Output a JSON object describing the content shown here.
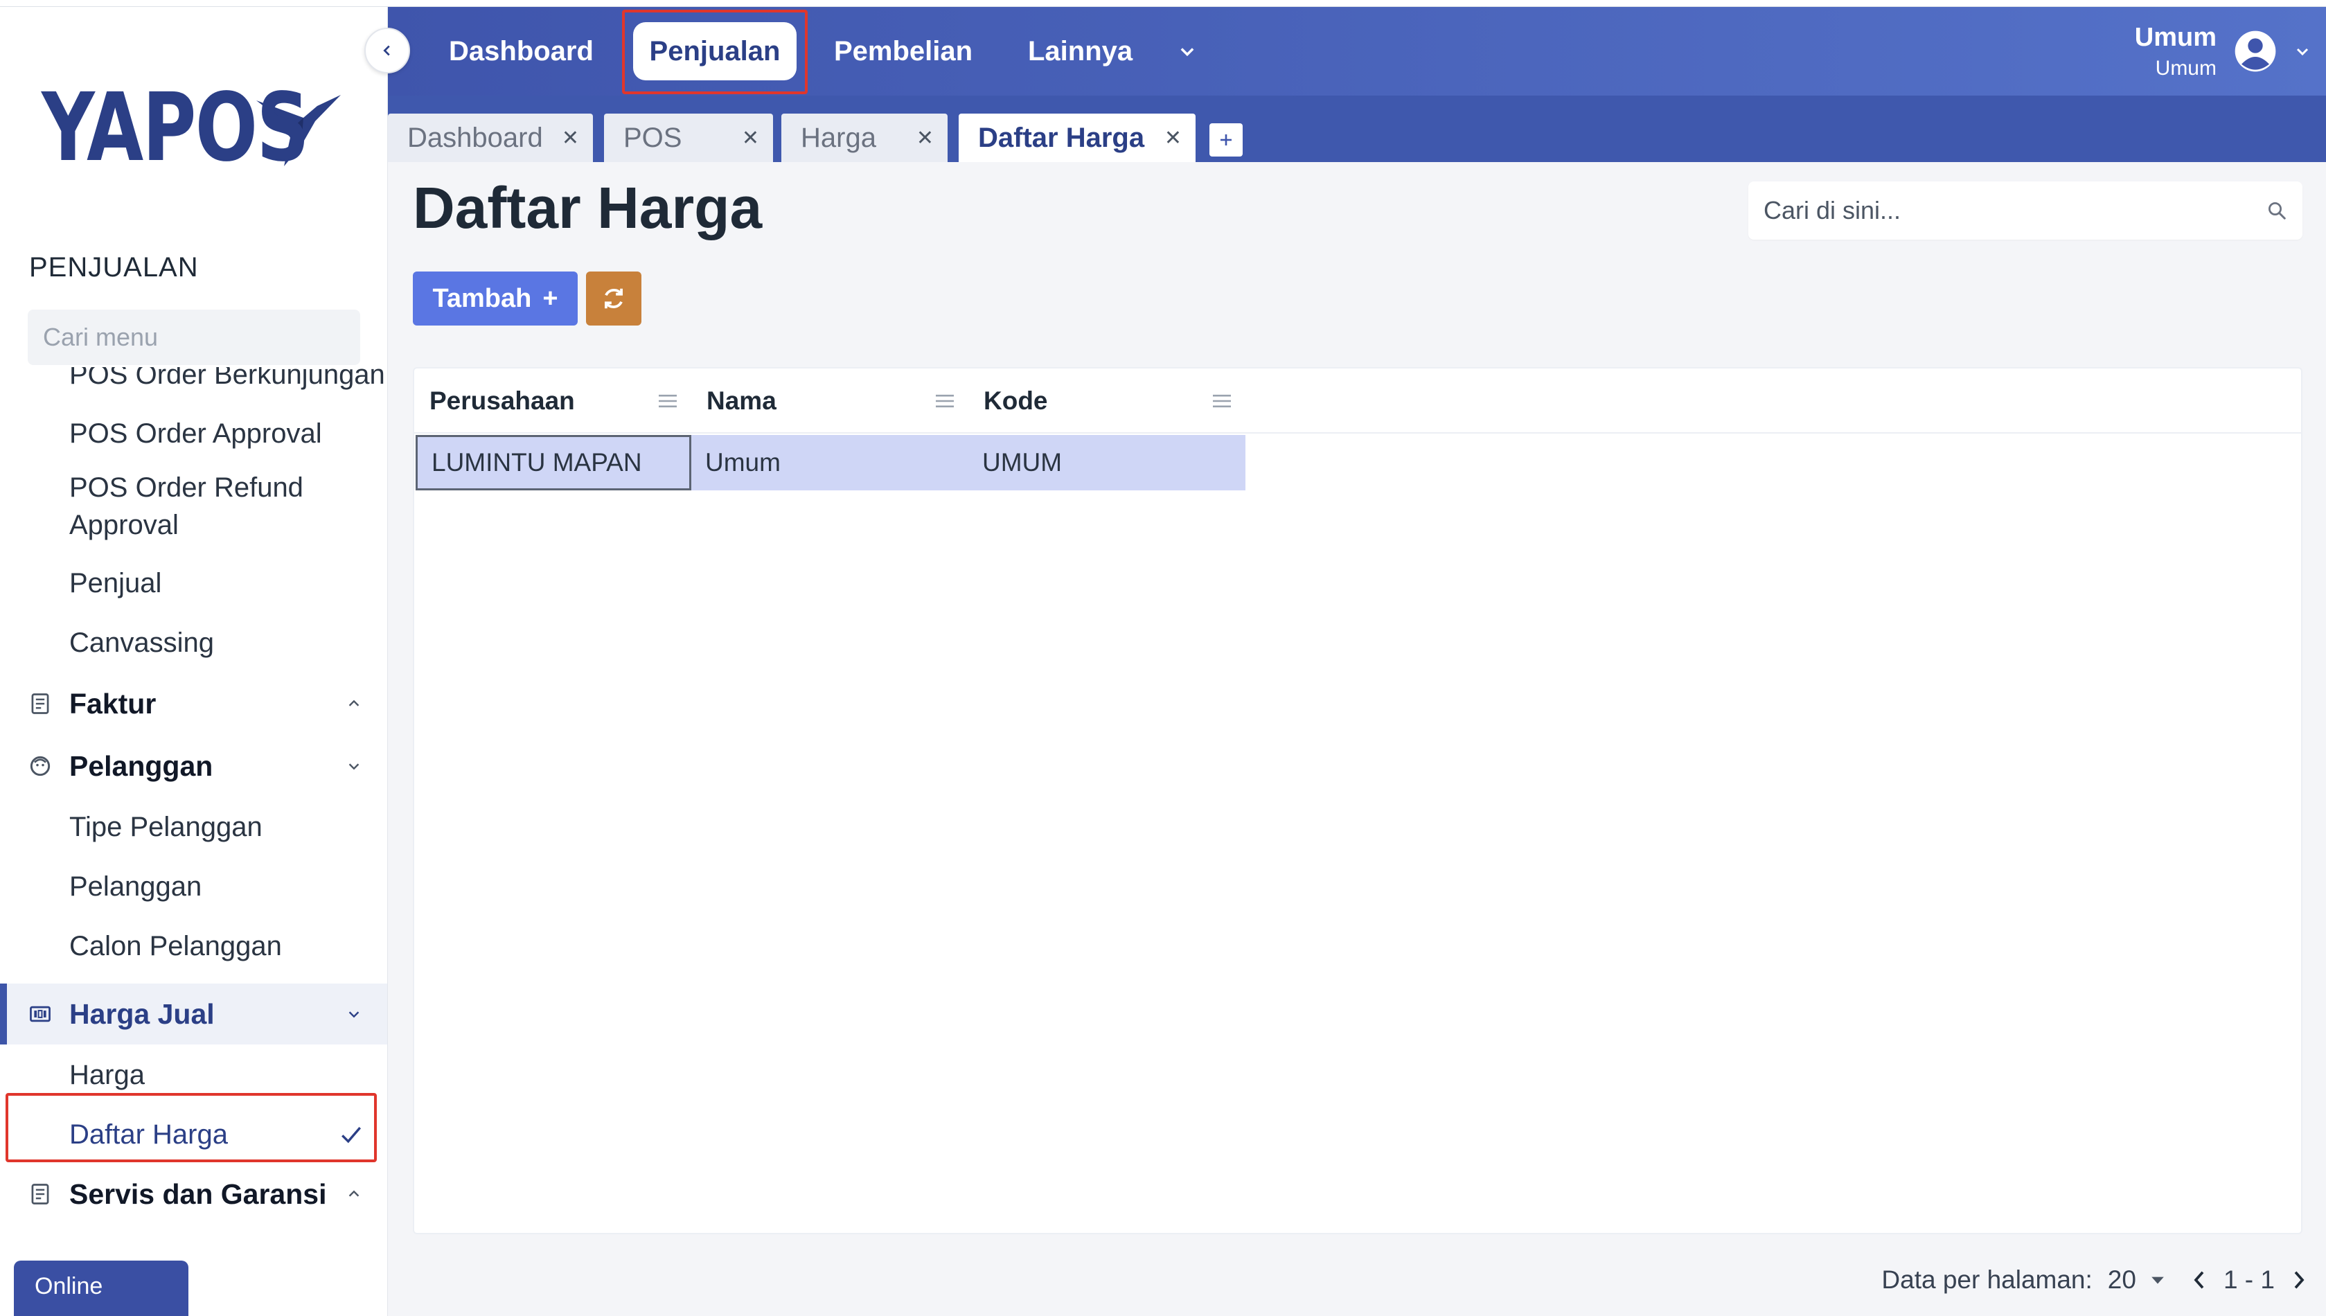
{
  "app": {
    "logo_text": "YAPOS",
    "status": "Online"
  },
  "sidebar": {
    "section_title": "PENJUALAN",
    "search_placeholder": "Cari menu",
    "partial_item": "POS Order Berkunjungan",
    "items": {
      "pos_order_approval": "POS Order Approval",
      "pos_order_refund_l1": "POS Order Refund",
      "pos_order_refund_l2": "Approval",
      "penjual": "Penjual",
      "canvassing": "Canvassing",
      "faktur": "Faktur",
      "pelanggan": "Pelanggan",
      "tipe_pelanggan": "Tipe Pelanggan",
      "pelanggan_sub": "Pelanggan",
      "calon_pelanggan": "Calon Pelanggan",
      "harga_jual": "Harga Jual",
      "harga": "Harga",
      "daftar_harga": "Daftar Harga",
      "servis_garansi": "Servis dan Garansi"
    }
  },
  "topnav": {
    "items": [
      "Dashboard",
      "Penjualan",
      "Pembelian",
      "Lainnya"
    ],
    "active": "Penjualan",
    "user_name": "Umum",
    "user_role": "Umum"
  },
  "tabs": [
    {
      "label": "Dashboard",
      "active": false
    },
    {
      "label": "POS",
      "active": false
    },
    {
      "label": "Harga",
      "active": false
    },
    {
      "label": "Daftar Harga",
      "active": true
    }
  ],
  "page": {
    "title": "Daftar Harga",
    "search_placeholder": "Cari di sini...",
    "add_button": "Tambah",
    "add_symbol": "+"
  },
  "table": {
    "columns": [
      "Perusahaan",
      "Nama",
      "Kode"
    ],
    "rows": [
      [
        "LUMINTU MAPAN",
        "Umum",
        "UMUM"
      ]
    ]
  },
  "pagination": {
    "label": "Data per halaman:",
    "per_page": "20",
    "range": "1 - 1"
  },
  "colors": {
    "primary": "#3f55ac",
    "accent_button": "#5a76e3",
    "refresh_button": "#c8813b",
    "highlight": "#e0362c",
    "selected_row": "#cfd6f6"
  }
}
